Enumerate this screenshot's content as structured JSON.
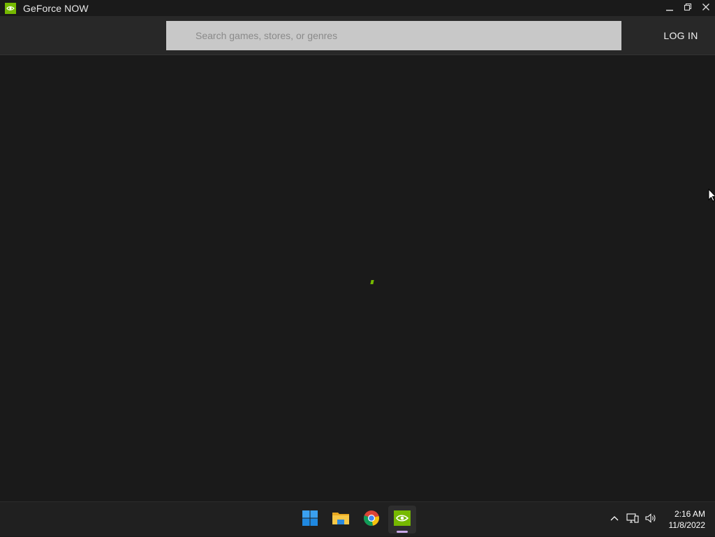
{
  "window": {
    "title": "GeForce NOW",
    "icon": "nvidia-logo-icon",
    "controls": [
      "minimize-icon",
      "restore-icon",
      "close-icon"
    ]
  },
  "header": {
    "search_placeholder": "Search games, stores, or genres",
    "login_label": "LOG IN"
  },
  "colors": {
    "accent": "#76b900",
    "background": "#1a1a1a",
    "header": "#282828",
    "search_bg": "#c8c8c8",
    "taskbar": "#202020"
  },
  "taskbar": {
    "apps": [
      {
        "name": "windows-start-icon"
      },
      {
        "name": "file-explorer-icon"
      },
      {
        "name": "chrome-icon"
      },
      {
        "name": "geforce-now-icon",
        "active": true
      }
    ],
    "tray": [
      "chevron-up-icon",
      "network-icon",
      "volume-icon"
    ],
    "time": "2:16 AM",
    "date": "11/8/2022"
  }
}
